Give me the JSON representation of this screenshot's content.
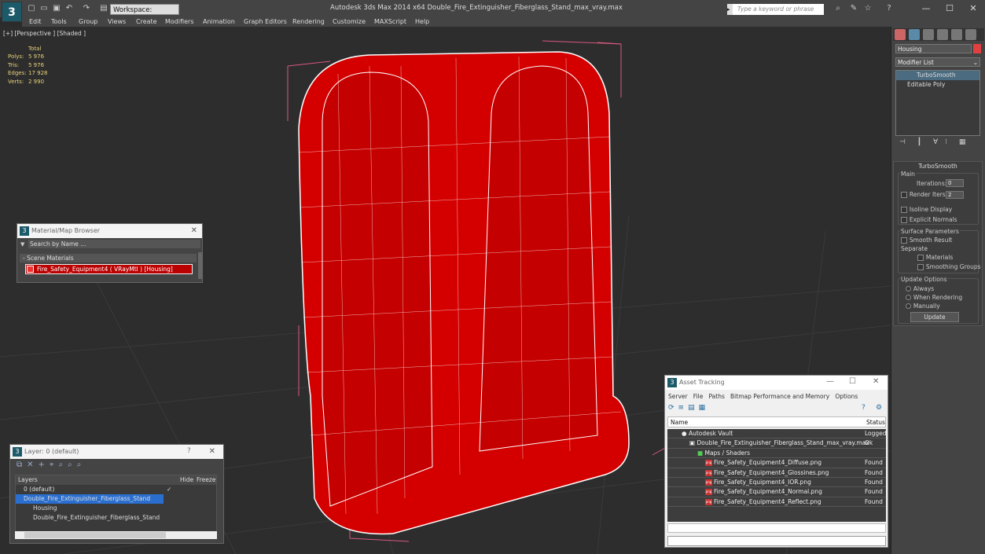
{
  "app": {
    "title": "Autodesk 3ds Max  2014 x64     Double_Fire_Extinguisher_Fiberglass_Stand_max_vray.max",
    "workspace": "Workspace: Default",
    "search_placeholder": "Type a keyword or phrase"
  },
  "menu": [
    "Edit",
    "Tools",
    "Group",
    "Views",
    "Create",
    "Modifiers",
    "Animation",
    "Graph Editors",
    "Rendering",
    "Customize",
    "MAXScript",
    "Help"
  ],
  "viewport": {
    "label": "[+] [Perspective ] [Shaded ]",
    "stats": {
      "header": "Total",
      "rows": [
        {
          "k": "Polys:",
          "v": "5 976"
        },
        {
          "k": "Tris:",
          "v": "5 976"
        },
        {
          "k": "Edges:",
          "v": "17 928"
        },
        {
          "k": "Verts:",
          "v": "2 990"
        }
      ]
    }
  },
  "command_panel": {
    "object_name": "Housing",
    "modifier_list": "Modifier List",
    "stack": [
      "TurboSmooth",
      "Editable Poly"
    ],
    "rollout_title": "TurboSmooth",
    "main_label": "Main",
    "iterations_label": "Iterations:",
    "iterations": "0",
    "render_iters_label": "Render Iters:",
    "render_iters": "2",
    "isoline": "Isoline Display",
    "explicit": "Explicit Normals",
    "surface_label": "Surface Parameters",
    "smooth_result": "Smooth Result",
    "separate": "Separate",
    "materials": "Materials",
    "smoothing_groups": "Smoothing Groups",
    "update_label": "Update Options",
    "always": "Always",
    "when_rendering": "When Rendering",
    "manually": "Manually",
    "update_btn": "Update"
  },
  "material_browser": {
    "title": "Material/Map Browser",
    "search": "Search by Name ...",
    "section": "- Scene Materials",
    "item": "Fire_Safety_Equipment4  ( VRayMtl )  [Housing]"
  },
  "layer_panel": {
    "title": "Layer: 0 (default)",
    "help": "?",
    "cols": [
      "Layers",
      "Hide",
      "Freeze"
    ],
    "rows": [
      "0 (default)",
      "Double_Fire_Extinguisher_Fiberglass_Stand",
      "Housing",
      "Double_Fire_Extinguisher_Fiberglass_Stand"
    ]
  },
  "asset_tracking": {
    "title": "Asset Tracking",
    "menu": [
      "Server",
      "File",
      "Paths",
      "Bitmap Performance and Memory",
      "Options"
    ],
    "col_name": "Name",
    "col_status": "Status",
    "rows": [
      {
        "name": "Autodesk Vault",
        "status": "Logged"
      },
      {
        "name": "Double_Fire_Extinguisher_Fiberglass_Stand_max_vray.max",
        "status": "Ok"
      },
      {
        "name": "Maps / Shaders",
        "status": ""
      },
      {
        "name": "Fire_Safety_Equipment4_Diffuse.png",
        "status": "Found"
      },
      {
        "name": "Fire_Safety_Equipment4_Glossines.png",
        "status": "Found"
      },
      {
        "name": "Fire_Safety_Equipment4_IOR.png",
        "status": "Found"
      },
      {
        "name": "Fire_Safety_Equipment4_Normal.png",
        "status": "Found"
      },
      {
        "name": "Fire_Safety_Equipment4_Reflect.png",
        "status": "Found"
      }
    ]
  }
}
